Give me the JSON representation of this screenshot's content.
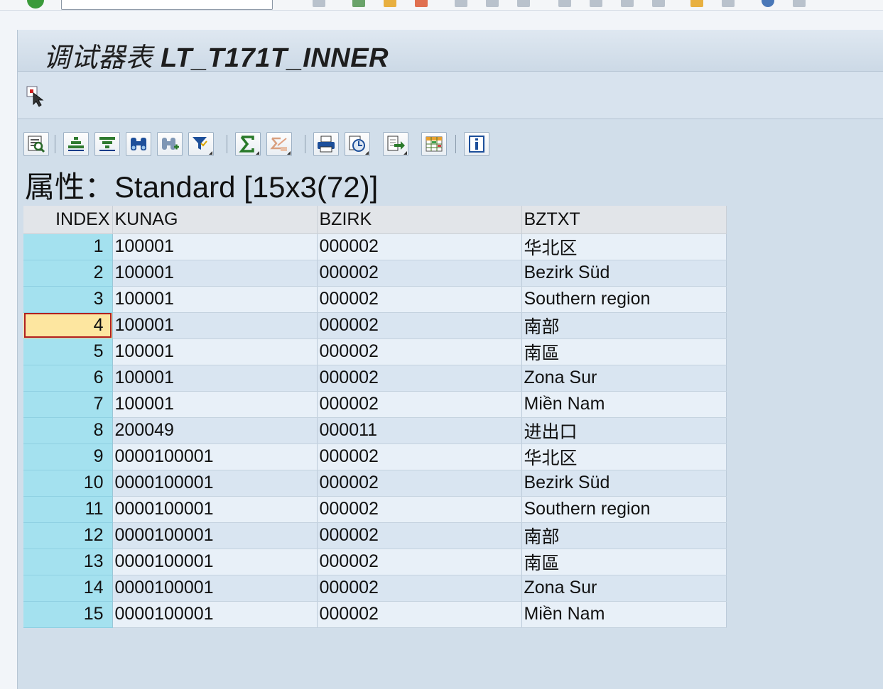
{
  "window": {
    "title_prefix": "调试器表",
    "title_name": "LT_T171T_INNER"
  },
  "alv_toolbar": {
    "buttons": [
      {
        "icon": "details-icon",
        "dropdown": false
      },
      {
        "icon": "sort-ascending-icon",
        "dropdown": false
      },
      {
        "icon": "sort-descending-icon",
        "dropdown": false
      },
      {
        "icon": "find-icon",
        "dropdown": false
      },
      {
        "icon": "find-next-icon",
        "dropdown": false
      },
      {
        "icon": "filter-icon",
        "dropdown": true
      },
      {
        "icon": "sum-icon",
        "dropdown": true
      },
      {
        "icon": "subtotal-icon",
        "dropdown": true
      },
      {
        "icon": "print-icon",
        "dropdown": false
      },
      {
        "icon": "views-icon",
        "dropdown": true
      },
      {
        "icon": "export-icon",
        "dropdown": true
      },
      {
        "icon": "layout-icon",
        "dropdown": false
      },
      {
        "icon": "info-icon",
        "dropdown": false
      }
    ]
  },
  "attributes": {
    "label": "属性：",
    "value": "Standard [15x3(72)]"
  },
  "table": {
    "columns": [
      "INDEX",
      "KUNAG",
      "BZIRK",
      "BZTXT"
    ],
    "selected_row": 4,
    "rows": [
      {
        "index": "1",
        "kunag": "100001",
        "bzirk": "000002",
        "bztxt": "华北区"
      },
      {
        "index": "2",
        "kunag": "100001",
        "bzirk": "000002",
        "bztxt": "Bezirk Süd"
      },
      {
        "index": "3",
        "kunag": "100001",
        "bzirk": "000002",
        "bztxt": "Southern region"
      },
      {
        "index": "4",
        "kunag": "100001",
        "bzirk": "000002",
        "bztxt": "南部"
      },
      {
        "index": "5",
        "kunag": "100001",
        "bzirk": "000002",
        "bztxt": "南區"
      },
      {
        "index": "6",
        "kunag": "100001",
        "bzirk": "000002",
        "bztxt": "Zona Sur"
      },
      {
        "index": "7",
        "kunag": "100001",
        "bzirk": "000002",
        "bztxt": "Miền Nam"
      },
      {
        "index": "8",
        "kunag": "200049",
        "bzirk": "000011",
        "bztxt": "进出口"
      },
      {
        "index": "9",
        "kunag": "0000100001",
        "bzirk": "000002",
        "bztxt": "华北区"
      },
      {
        "index": "10",
        "kunag": "0000100001",
        "bzirk": "000002",
        "bztxt": "Bezirk Süd"
      },
      {
        "index": "11",
        "kunag": "0000100001",
        "bzirk": "000002",
        "bztxt": "Southern region"
      },
      {
        "index": "12",
        "kunag": "0000100001",
        "bzirk": "000002",
        "bztxt": "南部"
      },
      {
        "index": "13",
        "kunag": "0000100001",
        "bzirk": "000002",
        "bztxt": "南區"
      },
      {
        "index": "14",
        "kunag": "0000100001",
        "bzirk": "000002",
        "bztxt": "Zona Sur"
      },
      {
        "index": "15",
        "kunag": "0000100001",
        "bzirk": "000002",
        "bztxt": "Miền Nam"
      }
    ]
  },
  "colors": {
    "index_column": "#a4e1ef",
    "selected_cell": "#fde6a0",
    "selection_border": "#b02020",
    "row_odd": "#e8f0f8",
    "row_even": "#d9e5f1",
    "header_bg": "#e2e5e9"
  }
}
